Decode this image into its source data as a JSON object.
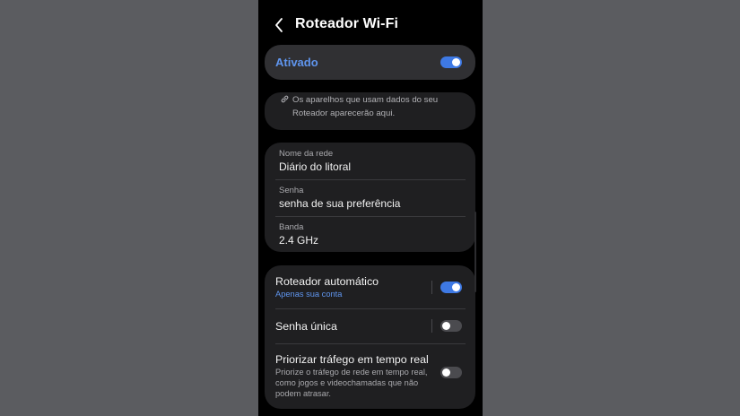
{
  "header": {
    "title": "Roteador Wi-Fi",
    "back_icon": "chevron-left-icon"
  },
  "master": {
    "label": "Ativado",
    "enabled": true,
    "accent_color": "#5f95ee"
  },
  "devices": {
    "icon": "link-icon",
    "line1": "Os aparelhos que usam dados do seu",
    "line2": "Roteador aparecerão aqui."
  },
  "network": {
    "fields": [
      {
        "label": "Nome da rede",
        "value": "Diário do litoral"
      },
      {
        "label": "Senha",
        "value": "senha de sua preferência"
      },
      {
        "label": "Banda",
        "value": "2.4 GHz"
      }
    ]
  },
  "options": {
    "auto_hotspot": {
      "title": "Roteador automático",
      "subtitle": "Apenas sua conta",
      "enabled": true
    },
    "one_time_password": {
      "title": "Senha única",
      "enabled": false
    },
    "prioritize_realtime": {
      "title": "Priorizar tráfego em tempo real",
      "desc_line1": "Priorize o tráfego de rede em tempo real,",
      "desc_line2": "como jogos e videochamadas que não",
      "desc_line3": "podem atrasar.",
      "enabled": false
    }
  },
  "colors": {
    "background": "#5b5c60",
    "screen": "#000000",
    "card": "#1f1f21",
    "toggle_on": "#3e79e4"
  }
}
